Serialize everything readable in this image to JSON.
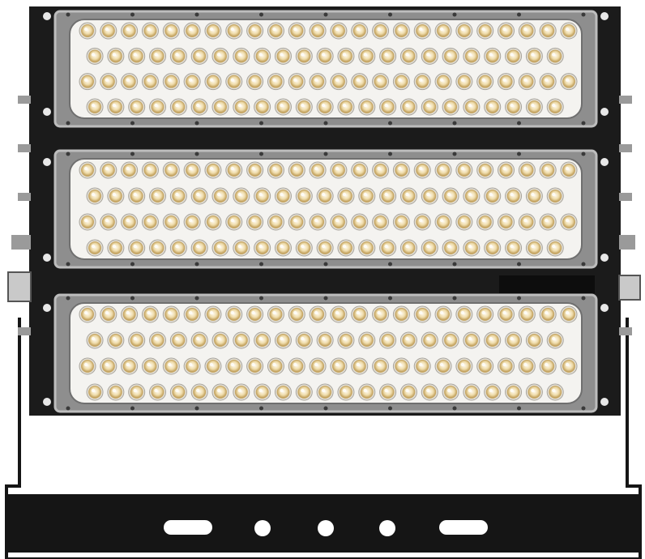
{
  "product": {
    "modules": [
      {
        "name": "top",
        "led_rows": 4,
        "leds_per_row": 24
      },
      {
        "name": "middle",
        "led_rows": 4,
        "leds_per_row": 24
      },
      {
        "name": "bottom",
        "led_rows": 4,
        "leds_per_row": 24
      }
    ],
    "bracket_slots": [
      "oval",
      "round",
      "round",
      "round",
      "oval"
    ]
  },
  "colors": {
    "frame": "#1b1b1b",
    "module_body": "#8e8e8e",
    "module_rim": "#bdbdbd",
    "led_board": "#f4f3f0",
    "led_core": "#ecd9a6",
    "led_ring": "#c7a866",
    "bracket": "#151515"
  }
}
